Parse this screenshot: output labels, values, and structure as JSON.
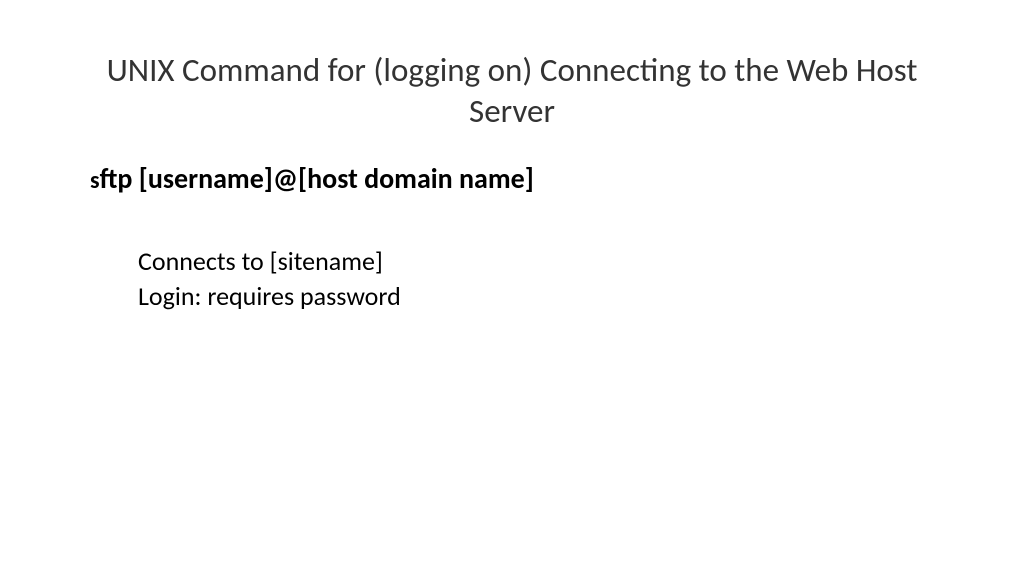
{
  "title": "UNIX Command for (logging on) Connecting to the Web Host Server",
  "command": {
    "prefix": "s",
    "rest": "ftp [username]@[host domain name]"
  },
  "description": {
    "line1": "Connects to [sitename]",
    "line2": "Login: requires password"
  }
}
